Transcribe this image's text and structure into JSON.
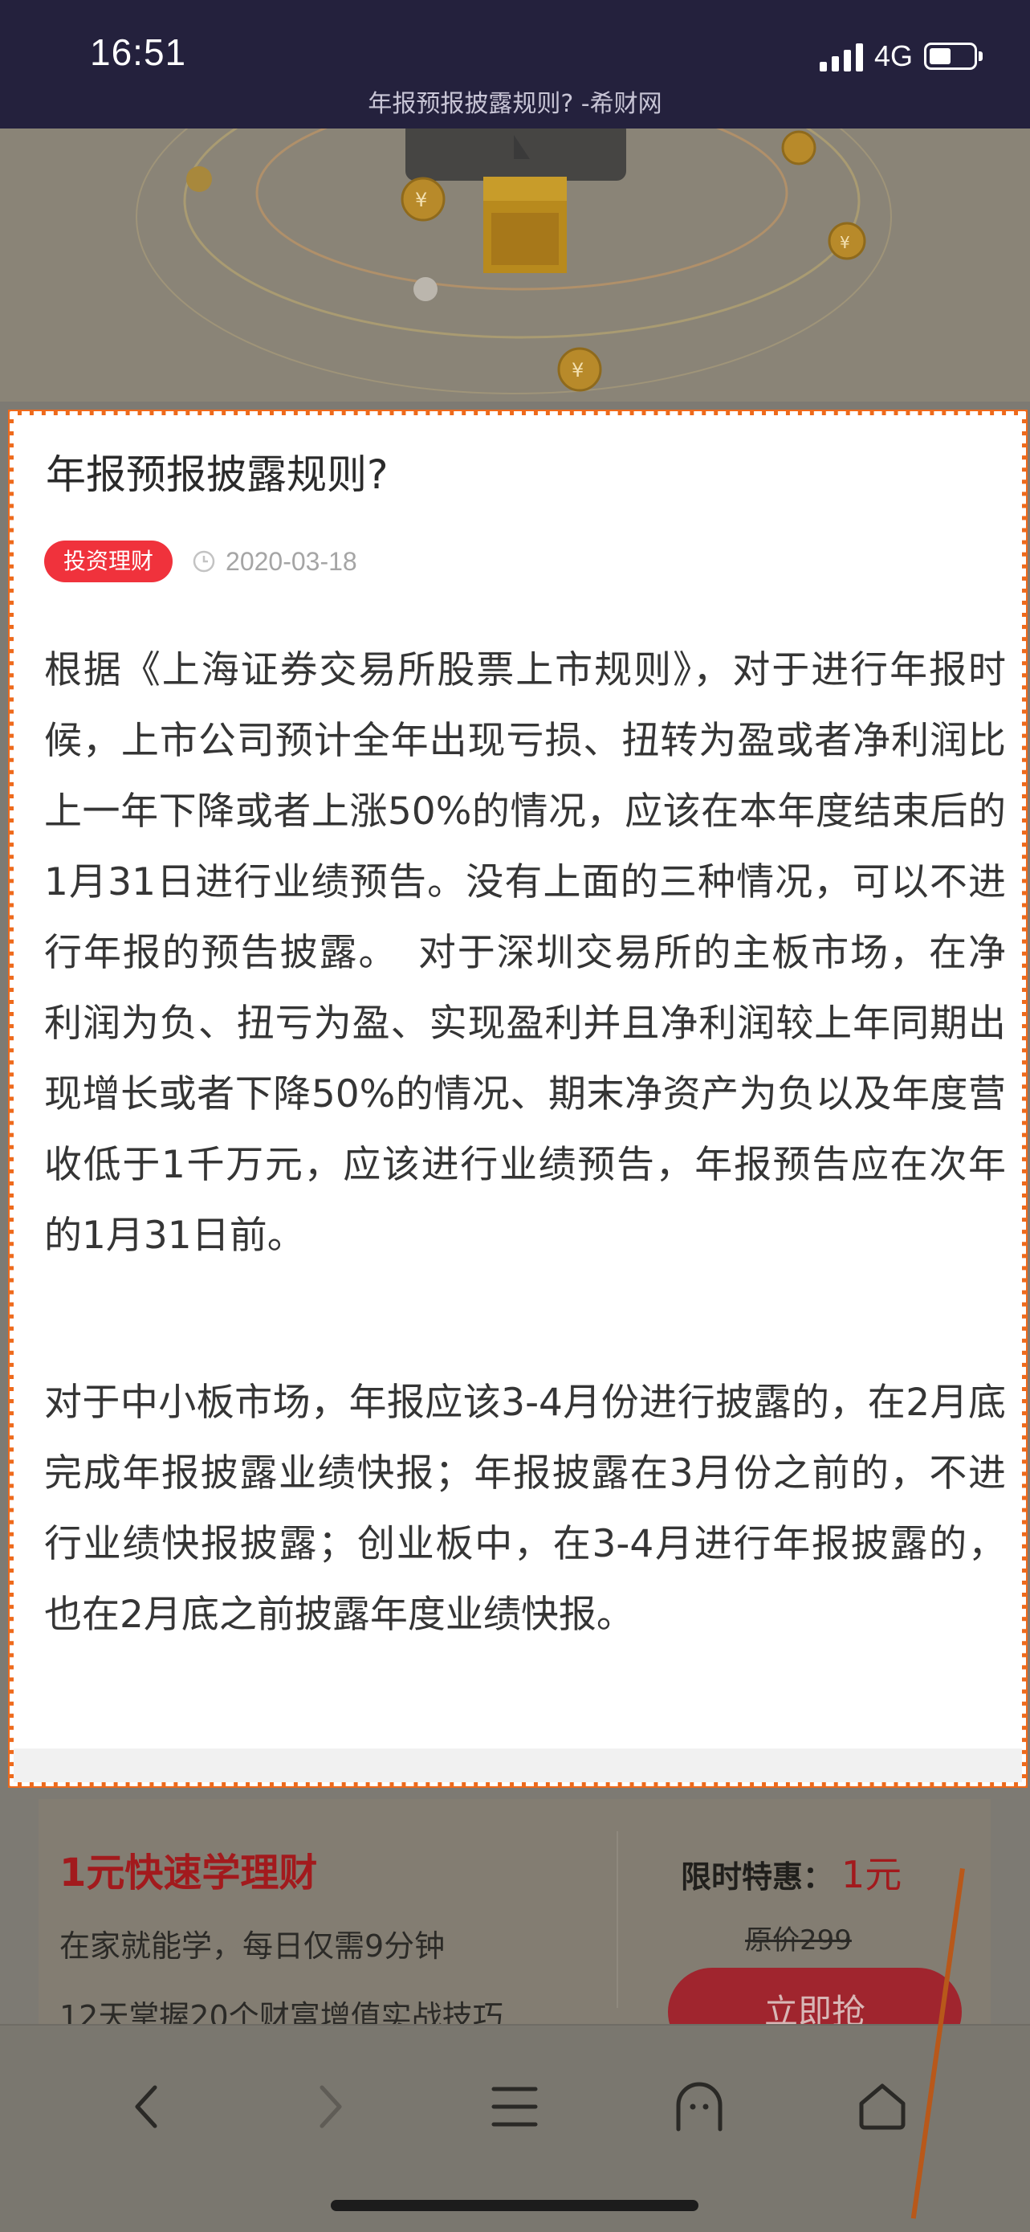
{
  "status_bar": {
    "time": "16:51",
    "network": "4G",
    "page_title": "年报预报披露规则? -希财网",
    "icons": [
      "signal-icon",
      "battery-icon"
    ]
  },
  "article": {
    "title": "年报预报披露规则?",
    "tag": "投资理财",
    "date": "2020-03-18",
    "paragraphs": [
      "根据《上海证券交易所股票上市规则》，对于进行年报时候，上市公司预计全年出现亏损、扭转为盈或者净利润比上一年下降或者上涨50%的情况，应该在本年度结束后的1月31日进行业绩预告。没有上面的三种情况，可以不进行年报的预告披露。　对于深圳交易所的主板市场，在净利润为负、扭亏为盈、实现盈利并且净利润较上年同期出现增长或者下降50%的情况、期末净资产为负以及年度营收低于1千万元，应该进行业绩预告，年报预告应在次年的1月31日前。",
      "对于中小板市场，年报应该3-4月份进行披露的，在2月底完成年报披露业绩快报；年报披露在3月份之前的，不进行业绩快报披露；创业板中，在3-4月进行年报披露的，也在2月底之前披露年度业绩快报。"
    ]
  },
  "promo": {
    "title": "1元快速学理财",
    "subtitle1": "在家就能学，每日仅需9分钟",
    "subtitle2": "12天掌握20个财富增值实战技巧",
    "price_label": "限时特惠：",
    "price_value": "1元",
    "original_price": "原价299",
    "cta": "立即抢"
  },
  "toolbar": {
    "icons": [
      "back-icon",
      "forward-icon",
      "menu-icon",
      "tabs-icon",
      "home-icon"
    ]
  },
  "colors": {
    "accent": "#ee6a1c",
    "tag_red": "#f0323c",
    "status_bar": "#24213d"
  }
}
